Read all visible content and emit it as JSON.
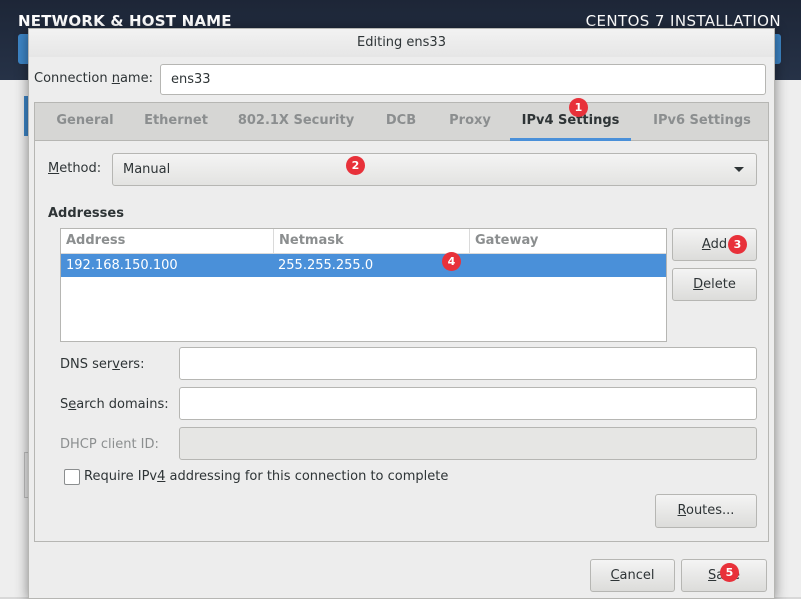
{
  "installer": {
    "header_title": "NETWORK & HOST NAME",
    "product_title": "CENTOS 7 INSTALLATION"
  },
  "dialog": {
    "title": "Editing ens33",
    "connection_name_label": "Connection name:",
    "connection_name_value": "ens33"
  },
  "tabs": [
    {
      "label": "General",
      "active": false
    },
    {
      "label": "Ethernet",
      "active": false
    },
    {
      "label": "802.1X Security",
      "active": false
    },
    {
      "label": "DCB",
      "active": false
    },
    {
      "label": "Proxy",
      "active": false
    },
    {
      "label": "IPv4 Settings",
      "active": true
    },
    {
      "label": "IPv6 Settings",
      "active": false
    }
  ],
  "ipv4": {
    "method_label": "Method:",
    "method_value": "Manual",
    "addresses_title": "Addresses",
    "columns": [
      "Address",
      "Netmask",
      "Gateway"
    ],
    "rows": [
      {
        "address": "192.168.150.100",
        "netmask": "255.255.255.0",
        "gateway": ""
      }
    ],
    "add_label": "Add",
    "delete_label": "Delete",
    "dns_label": "DNS servers:",
    "dns_value": "",
    "search_label": "Search domains:",
    "search_value": "",
    "dhcp_label": "DHCP client ID:",
    "dhcp_value": "",
    "require_label": "Require IPv4 addressing for this connection to complete",
    "require_checked": false,
    "routes_label": "Routes..."
  },
  "footer": {
    "cancel_label": "Cancel",
    "save_label": "Save"
  },
  "markers": [
    "1",
    "2",
    "3",
    "4",
    "5"
  ],
  "colors": {
    "accent": "#4a90d9",
    "marker": "#e8313a",
    "header_bg": "#1d2637"
  }
}
